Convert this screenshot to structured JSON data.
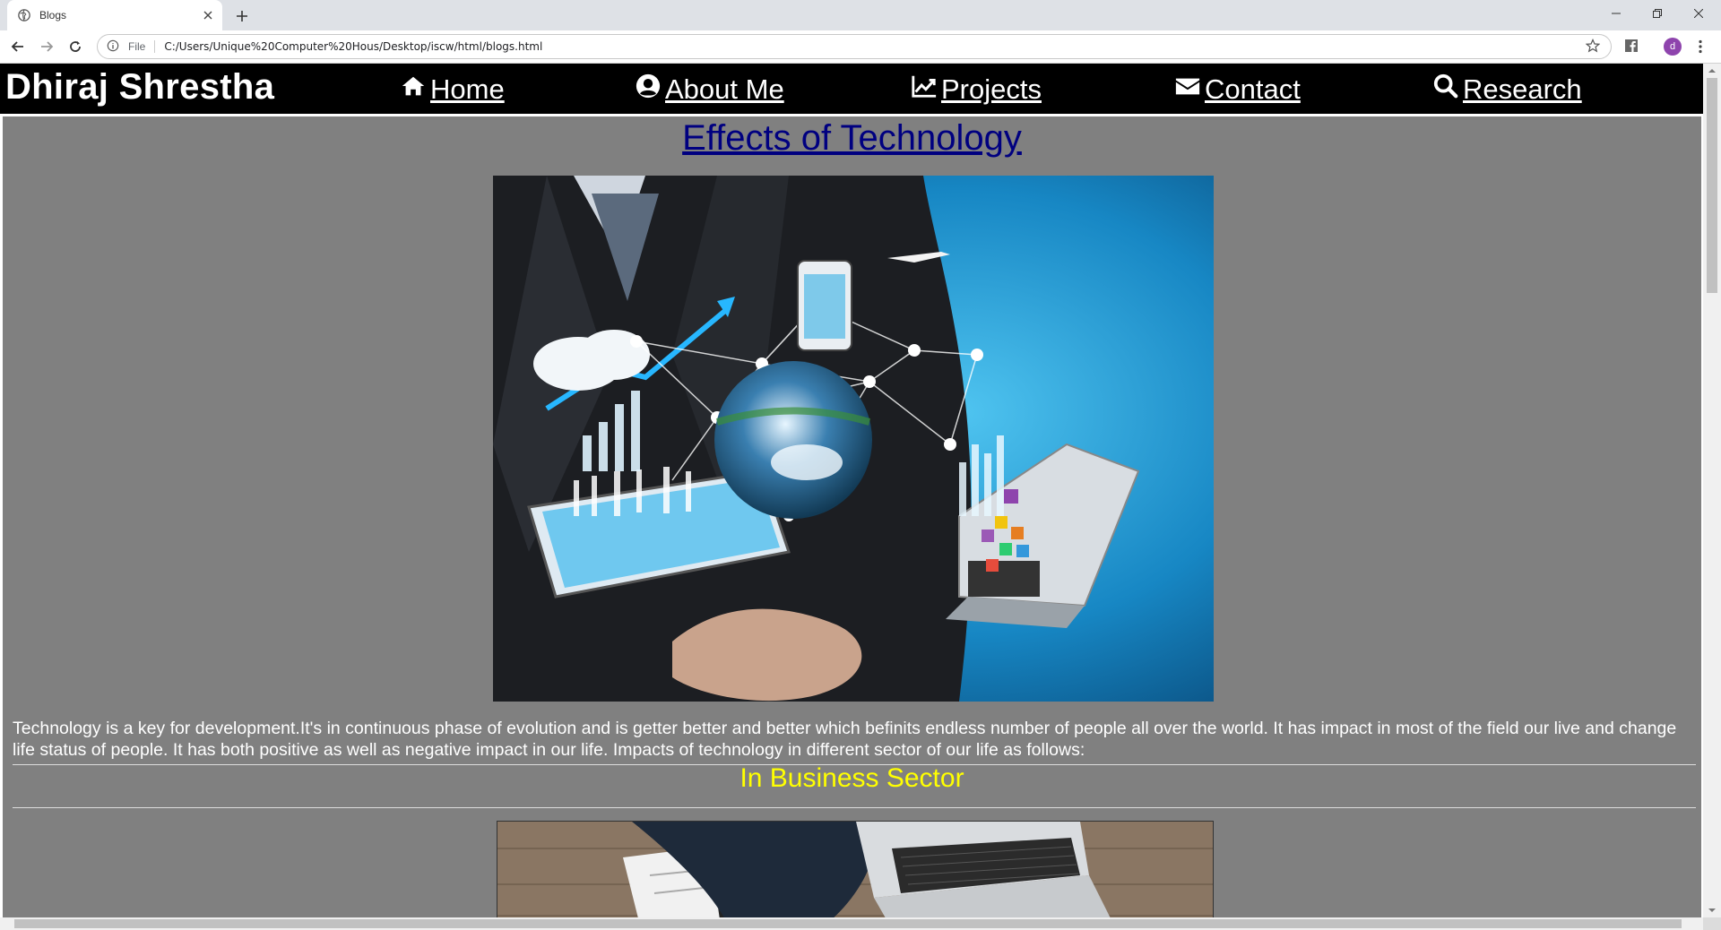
{
  "browser": {
    "tab_title": "Blogs",
    "scheme_label": "File",
    "url": "C:/Users/Unique%20Computer%20Hous/Desktop/iscw/html/blogs.html",
    "profile_initial": "d",
    "profile_color": "#8e44ad"
  },
  "site": {
    "brand": "Dhiraj Shrestha",
    "nav": [
      {
        "label": "Home",
        "icon": "home-icon"
      },
      {
        "label": "About Me",
        "icon": "user-circle-icon"
      },
      {
        "label": "Projects",
        "icon": "line-chart-icon"
      },
      {
        "label": "Contact",
        "icon": "envelope-icon"
      },
      {
        "label": "Research",
        "icon": "search-icon"
      }
    ]
  },
  "article": {
    "title": "Effects of Technology",
    "hero_image": "technology-network-hand-image",
    "intro": "Technology is a key for development.It's in continuous phase of evolution and is getter better and better which befinits endless number of people all over the world. It has impact in most of the field our live and change life status of people. It has both positive as well as negative impact in our life. Impacts of technology in different sector of our life as follows:",
    "sections": [
      {
        "heading": "In Business Sector",
        "image": "business-laptop-desk-image"
      }
    ]
  },
  "colors": {
    "nav_bg": "#000000",
    "content_bg": "#808080",
    "title_link": "#000080",
    "section_heading": "#ffff00"
  }
}
